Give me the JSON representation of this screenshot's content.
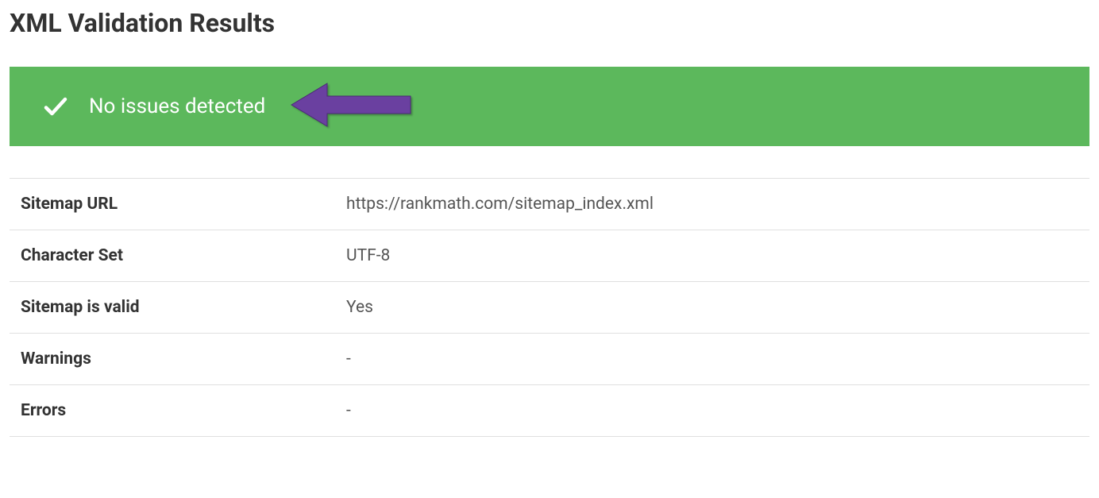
{
  "page": {
    "title": "XML Validation Results"
  },
  "status": {
    "message": "No issues detected"
  },
  "details": {
    "rows": [
      {
        "label": "Sitemap URL",
        "value": "https://rankmath.com/sitemap_index.xml"
      },
      {
        "label": "Character Set",
        "value": "UTF-8"
      },
      {
        "label": "Sitemap is valid",
        "value": "Yes"
      },
      {
        "label": "Warnings",
        "value": "-"
      },
      {
        "label": "Errors",
        "value": "-"
      }
    ]
  }
}
